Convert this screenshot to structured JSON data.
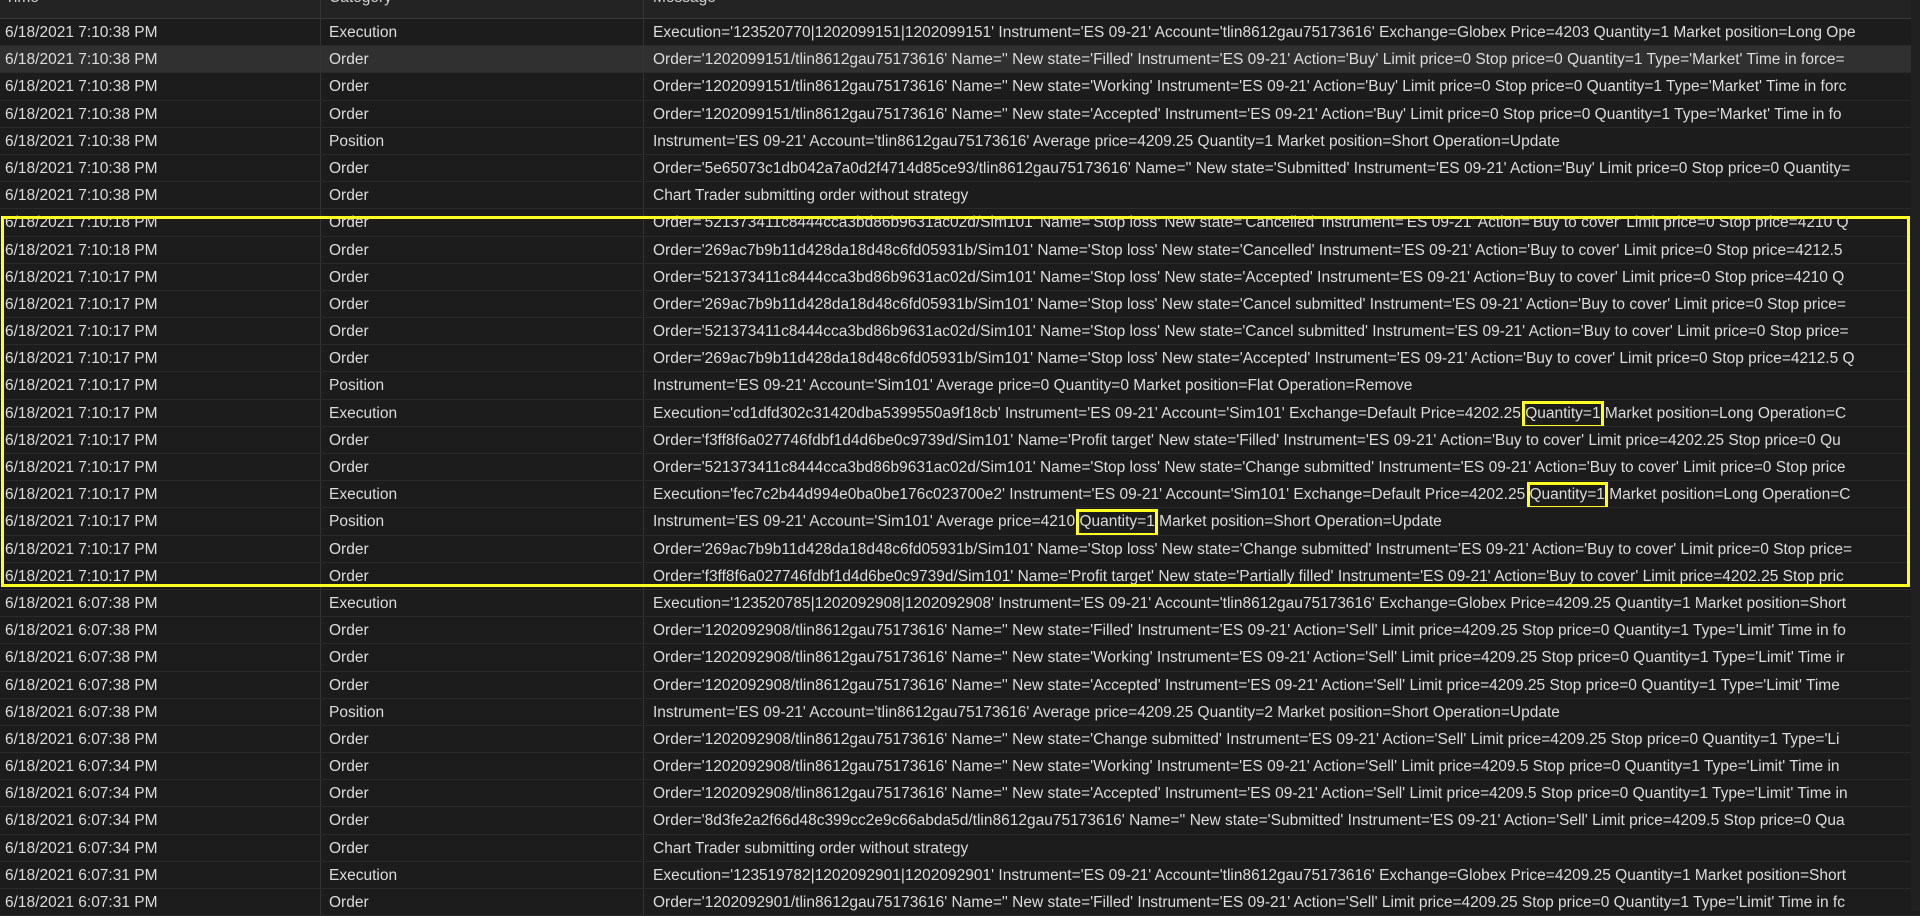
{
  "columns": {
    "time": "Time",
    "category": "Category",
    "message": "Message"
  },
  "rows": [
    {
      "time": "6/18/2021 7:10:38 PM",
      "category": "Execution",
      "message": "Execution='123520770|1202099151|1202099151' Instrument='ES 09-21' Account='tlin8612gau75173616' Exchange=Globex Price=4203 Quantity=1 Market position=Long Ope"
    },
    {
      "time": "6/18/2021 7:10:38 PM",
      "category": "Order",
      "message": "Order='1202099151/tlin8612gau75173616' Name='' New state='Filled' Instrument='ES 09-21' Action='Buy' Limit price=0 Stop price=0 Quantity=1 Type='Market' Time in force="
    },
    {
      "time": "6/18/2021 7:10:38 PM",
      "category": "Order",
      "message": "Order='1202099151/tlin8612gau75173616' Name='' New state='Working' Instrument='ES 09-21' Action='Buy' Limit price=0 Stop price=0 Quantity=1 Type='Market' Time in forc"
    },
    {
      "time": "6/18/2021 7:10:38 PM",
      "category": "Order",
      "message": "Order='1202099151/tlin8612gau75173616' Name='' New state='Accepted' Instrument='ES 09-21' Action='Buy' Limit price=0 Stop price=0 Quantity=1 Type='Market' Time in fo"
    },
    {
      "time": "6/18/2021 7:10:38 PM",
      "category": "Position",
      "message": "Instrument='ES 09-21' Account='tlin8612gau75173616' Average price=4209.25 Quantity=1 Market position=Short Operation=Update"
    },
    {
      "time": "6/18/2021 7:10:38 PM",
      "category": "Order",
      "message": "Order='5e65073c1db042a7a0d2f4714d85ce93/tlin8612gau75173616' Name='' New state='Submitted' Instrument='ES 09-21' Action='Buy' Limit price=0 Stop price=0 Quantity="
    },
    {
      "time": "6/18/2021 7:10:38 PM",
      "category": "Order",
      "message": "Chart Trader submitting order without strategy"
    },
    {
      "time": "6/18/2021 7:10:18 PM",
      "category": "Order",
      "message": "Order='521373411c8444cca3bd86b9631ac02d/Sim101' Name='Stop loss' New state='Cancelled' Instrument='ES 09-21' Action='Buy to cover' Limit price=0 Stop price=4210 Q"
    },
    {
      "time": "6/18/2021 7:10:18 PM",
      "category": "Order",
      "message": "Order='269ac7b9b11d428da18d48c6fd05931b/Sim101' Name='Stop loss' New state='Cancelled' Instrument='ES 09-21' Action='Buy to cover' Limit price=0 Stop price=4212.5"
    },
    {
      "time": "6/18/2021 7:10:17 PM",
      "category": "Order",
      "message": "Order='521373411c8444cca3bd86b9631ac02d/Sim101' Name='Stop loss' New state='Accepted' Instrument='ES 09-21' Action='Buy to cover' Limit price=0 Stop price=4210 Q"
    },
    {
      "time": "6/18/2021 7:10:17 PM",
      "category": "Order",
      "message": "Order='269ac7b9b11d428da18d48c6fd05931b/Sim101' Name='Stop loss' New state='Cancel submitted' Instrument='ES 09-21' Action='Buy to cover' Limit price=0 Stop price="
    },
    {
      "time": "6/18/2021 7:10:17 PM",
      "category": "Order",
      "message": "Order='521373411c8444cca3bd86b9631ac02d/Sim101' Name='Stop loss' New state='Cancel submitted' Instrument='ES 09-21' Action='Buy to cover' Limit price=0 Stop price="
    },
    {
      "time": "6/18/2021 7:10:17 PM",
      "category": "Order",
      "message": "Order='269ac7b9b11d428da18d48c6fd05931b/Sim101' Name='Stop loss' New state='Accepted' Instrument='ES 09-21' Action='Buy to cover' Limit price=0 Stop price=4212.5 Q"
    },
    {
      "time": "6/18/2021 7:10:17 PM",
      "category": "Position",
      "message": "Instrument='ES 09-21' Account='Sim101' Average price=0 Quantity=0 Market position=Flat Operation=Remove"
    },
    {
      "time": "6/18/2021 7:10:17 PM",
      "category": "Execution",
      "message_pre": "Execution='cd1dfd302c31420dba5399550a9f18cb' Instrument='ES 09-21' Account='Sim101' Exchange=Default Price=4202.25 ",
      "message_qty": "Quantity=1",
      "message_post": " Market position=Long Operation=C"
    },
    {
      "time": "6/18/2021 7:10:17 PM",
      "category": "Order",
      "message": "Order='f3ff8f6a027746fdbf1d4d6be0c9739d/Sim101' Name='Profit target' New state='Filled' Instrument='ES 09-21' Action='Buy to cover' Limit price=4202.25 Stop price=0 Qu"
    },
    {
      "time": "6/18/2021 7:10:17 PM",
      "category": "Order",
      "message": "Order='521373411c8444cca3bd86b9631ac02d/Sim101' Name='Stop loss' New state='Change submitted' Instrument='ES 09-21' Action='Buy to cover' Limit price=0 Stop price"
    },
    {
      "time": "6/18/2021 7:10:17 PM",
      "category": "Execution",
      "message_pre": "Execution='fec7c2b44d994e0ba0be176c023700e2' Instrument='ES 09-21' Account='Sim101' Exchange=Default Price=4202.25 ",
      "message_qty": "Quantity=1",
      "message_post": " Market position=Long Operation=C"
    },
    {
      "time": "6/18/2021 7:10:17 PM",
      "category": "Position",
      "message_pre": "Instrument='ES 09-21' Account='Sim101' Average price=4210 ",
      "message_qty": "Quantity=1",
      "message_post": " Market position=Short Operation=Update"
    },
    {
      "time": "6/18/2021 7:10:17 PM",
      "category": "Order",
      "message": "Order='269ac7b9b11d428da18d48c6fd05931b/Sim101' Name='Stop loss' New state='Change submitted' Instrument='ES 09-21' Action='Buy to cover' Limit price=0 Stop price="
    },
    {
      "time": "6/18/2021 7:10:17 PM",
      "category": "Order",
      "message": "Order='f3ff8f6a027746fdbf1d4d6be0c9739d/Sim101' Name='Profit target' New state='Partially filled' Instrument='ES 09-21' Action='Buy to cover' Limit price=4202.25 Stop pric"
    },
    {
      "time": "6/18/2021 6:07:38 PM",
      "category": "Execution",
      "message": "Execution='123520785|1202092908|1202092908' Instrument='ES 09-21' Account='tlin8612gau75173616' Exchange=Globex Price=4209.25 Quantity=1 Market position=Short"
    },
    {
      "time": "6/18/2021 6:07:38 PM",
      "category": "Order",
      "message": "Order='1202092908/tlin8612gau75173616' Name='' New state='Filled' Instrument='ES 09-21' Action='Sell' Limit price=4209.25 Stop price=0 Quantity=1 Type='Limit' Time in fo"
    },
    {
      "time": "6/18/2021 6:07:38 PM",
      "category": "Order",
      "message": "Order='1202092908/tlin8612gau75173616' Name='' New state='Working' Instrument='ES 09-21' Action='Sell' Limit price=4209.25 Stop price=0 Quantity=1 Type='Limit' Time ir"
    },
    {
      "time": "6/18/2021 6:07:38 PM",
      "category": "Order",
      "message": "Order='1202092908/tlin8612gau75173616' Name='' New state='Accepted' Instrument='ES 09-21' Action='Sell' Limit price=4209.25 Stop price=0 Quantity=1 Type='Limit' Time"
    },
    {
      "time": "6/18/2021 6:07:38 PM",
      "category": "Position",
      "message": "Instrument='ES 09-21' Account='tlin8612gau75173616' Average price=4209.25 Quantity=2 Market position=Short Operation=Update"
    },
    {
      "time": "6/18/2021 6:07:38 PM",
      "category": "Order",
      "message": "Order='1202092908/tlin8612gau75173616' Name='' New state='Change submitted' Instrument='ES 09-21' Action='Sell' Limit price=4209.25 Stop price=0 Quantity=1 Type='Li"
    },
    {
      "time": "6/18/2021 6:07:34 PM",
      "category": "Order",
      "message": "Order='1202092908/tlin8612gau75173616' Name='' New state='Working' Instrument='ES 09-21' Action='Sell' Limit price=4209.5 Stop price=0 Quantity=1 Type='Limit' Time in"
    },
    {
      "time": "6/18/2021 6:07:34 PM",
      "category": "Order",
      "message": "Order='1202092908/tlin8612gau75173616' Name='' New state='Accepted' Instrument='ES 09-21' Action='Sell' Limit price=4209.5 Stop price=0 Quantity=1 Type='Limit' Time in"
    },
    {
      "time": "6/18/2021 6:07:34 PM",
      "category": "Order",
      "message": "Order='8d3fe2a2f66d48c399cc2e9c66abda5d/tlin8612gau75173616' Name='' New state='Submitted' Instrument='ES 09-21' Action='Sell' Limit price=4209.5 Stop price=0 Qua"
    },
    {
      "time": "6/18/2021 6:07:34 PM",
      "category": "Order",
      "message": "Chart Trader submitting order without strategy"
    },
    {
      "time": "6/18/2021 6:07:31 PM",
      "category": "Execution",
      "message": "Execution='123519782|1202092901|1202092901' Instrument='ES 09-21' Account='tlin8612gau75173616' Exchange=Globex Price=4209.25 Quantity=1 Market position=Short"
    },
    {
      "time": "6/18/2021 6:07:31 PM",
      "category": "Order",
      "message": "Order='1202092901/tlin8612gau75173616' Name='' New state='Filled' Instrument='ES 09-21' Action='Sell' Limit price=4209.25 Stop price=0 Quantity=1 Type='Limit' Time in fc"
    }
  ],
  "selected_row": 1,
  "highlight_color": "#ffff22"
}
